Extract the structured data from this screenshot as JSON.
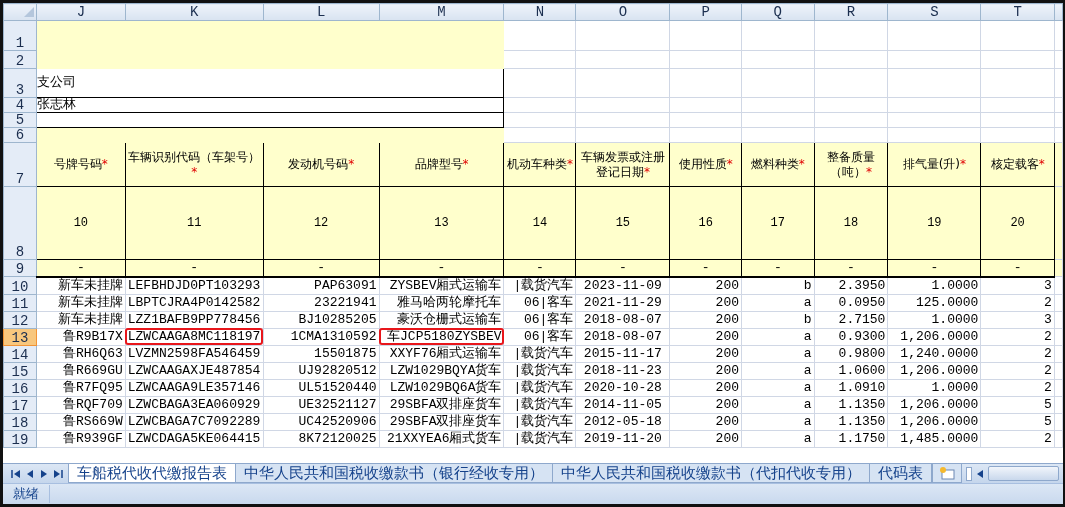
{
  "columns": [
    "J",
    "K",
    "L",
    "M",
    "N",
    "O",
    "P",
    "Q",
    "R",
    "S",
    "T"
  ],
  "banner_rows": [
    {
      "number": "1",
      "kind": "fill"
    },
    {
      "number": "2",
      "kind": "fill"
    },
    {
      "number": "3",
      "kind": "field",
      "text": "支公司"
    },
    {
      "number": "4",
      "kind": "field",
      "text": "张志林"
    },
    {
      "number": "5",
      "kind": "field"
    },
    {
      "number": "6",
      "kind": "fill"
    }
  ],
  "header": {
    "number": "7",
    "cells": [
      {
        "label": "号牌号码",
        "mark": "*"
      },
      {
        "label": "车辆识别代码（车架号）",
        "mark": "*"
      },
      {
        "label": "发动机号码",
        "mark": "*"
      },
      {
        "label": "品牌型号",
        "mark": "*"
      },
      {
        "label": "机动车种类",
        "mark": "*"
      },
      {
        "label": "车辆发票或注册登记日期",
        "mark": "*"
      },
      {
        "label": "使用性质",
        "mark": "*"
      },
      {
        "label": "燃料种类",
        "mark": "*"
      },
      {
        "label": "整备质量（吨）",
        "mark": "*"
      },
      {
        "label": "排气量(升)",
        "mark": "*"
      },
      {
        "label": "核定载客",
        "mark": "*"
      }
    ]
  },
  "index_row": {
    "number": "8",
    "cells": [
      "10",
      "11",
      "12",
      "13",
      "14",
      "15",
      "16",
      "17",
      "18",
      "19",
      "20"
    ]
  },
  "dash_row": {
    "number": "9",
    "cells": [
      "-",
      "-",
      "-",
      "-",
      "-",
      "-",
      "-",
      "-",
      "-",
      "-",
      "-"
    ]
  },
  "rows": [
    {
      "number": "10",
      "selected": false,
      "cells": [
        "新车未挂牌",
        "LEFBHDJD0PT103293",
        "PAP63091",
        "ZYSBEV厢式运输车",
        "|载货汽车",
        "2023-11-09",
        "200",
        "b",
        "2.3950",
        "1.0000",
        "3"
      ]
    },
    {
      "number": "11",
      "selected": false,
      "cells": [
        "新车未挂牌",
        "LBPTCJRA4P0142582",
        "23221941",
        "雅马哈两轮摩托车",
        "06|客车",
        "2021-11-29",
        "200",
        "a",
        "0.0950",
        "125.0000",
        "2"
      ]
    },
    {
      "number": "12",
      "selected": false,
      "cells": [
        "新车未挂牌",
        "LZZ1BAFB9PP778456",
        "BJ10285205",
        "豪沃仓栅式运输车",
        "06|客车",
        "2018-08-07",
        "200",
        "b",
        "2.7150",
        "1.0000",
        "3"
      ]
    },
    {
      "number": "13",
      "selected": true,
      "cells": [
        "鲁R9B17X",
        {
          "text": "LZWCAAGA8MC118197",
          "outlined": true
        },
        "1CMA1310592",
        {
          "text": "车JCP5180ZYSBEV",
          "outlined": true
        },
        "06|客车",
        "2018-08-07",
        "200",
        "a",
        "0.9300",
        "1,206.0000",
        "2"
      ]
    },
    {
      "number": "14",
      "selected": false,
      "cells": [
        "鲁RH6Q63",
        "LVZMN2598FA546459",
        "15501875",
        "XXYF76厢式运输车",
        "|载货汽车",
        "2015-11-17",
        "200",
        "a",
        "0.9800",
        "1,240.0000",
        "2"
      ]
    },
    {
      "number": "15",
      "selected": false,
      "cells": [
        "鲁R669GU",
        "LZWCAAGAXJE487854",
        "UJ92820512",
        "LZW1029BQYA货车",
        "|载货汽车",
        "2018-11-23",
        "200",
        "a",
        "1.0600",
        "1,206.0000",
        "2"
      ]
    },
    {
      "number": "16",
      "selected": false,
      "cells": [
        "鲁R7FQ95",
        "LZWCAAGA9LE357146",
        "UL51520440",
        "LZW1029BQ6A货车",
        "|载货汽车",
        "2020-10-28",
        "200",
        "a",
        "1.0910",
        "1.0000",
        "2"
      ]
    },
    {
      "number": "17",
      "selected": false,
      "cells": [
        "鲁RQF709",
        "LZWCBAGA3EA060929",
        "UE32521127",
        "29SBFA双排座货车",
        "|载货汽车",
        "2014-11-05",
        "200",
        "a",
        "1.1350",
        "1,206.0000",
        "5"
      ]
    },
    {
      "number": "18",
      "selected": false,
      "cells": [
        "鲁RS669W",
        "LZWCBAGA7C7092289",
        "UC42520906",
        "29SBFA双排座货车",
        "|载货汽车",
        "2012-05-18",
        "200",
        "a",
        "1.1350",
        "1,206.0000",
        "5"
      ]
    },
    {
      "number": "19",
      "selected": false,
      "cells": [
        "鲁R939GF",
        "LZWCDAGA5KE064415",
        "8K72120025",
        "21XXYEA6厢式货车",
        "|载货汽车",
        "2019-11-20",
        "200",
        "a",
        "1.1750",
        "1,485.0000",
        "2"
      ]
    }
  ],
  "tabs": [
    {
      "label": "车船税代收代缴报告表",
      "selected": true
    },
    {
      "label": "中华人民共和国税收缴款书（银行经收专用）",
      "selected": false
    },
    {
      "label": "中华人民共和国税收缴款书（代扣代收专用）",
      "selected": false
    },
    {
      "label": "代码表",
      "selected": false
    }
  ],
  "status_bar": {
    "text": "就绪"
  }
}
